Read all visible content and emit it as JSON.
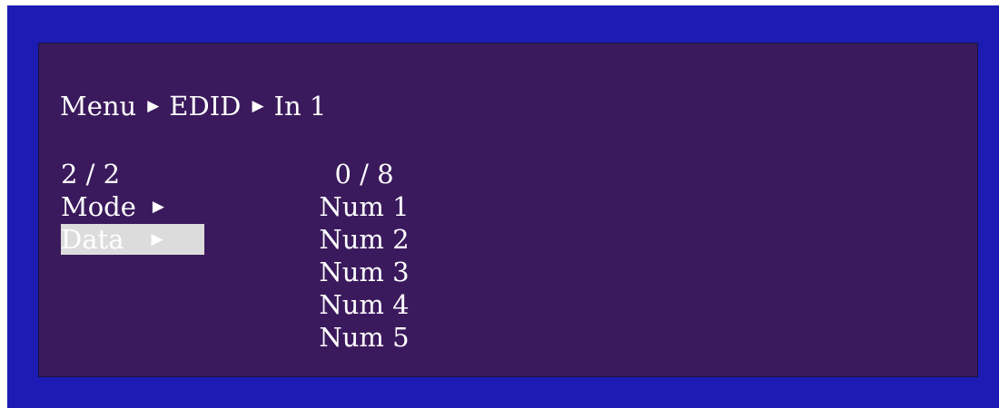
{
  "breadcrumb": {
    "items": [
      "Menu",
      "EDID",
      "In 1"
    ],
    "separator": "▶"
  },
  "left_menu": {
    "page": "2 / 2",
    "items": [
      {
        "label": "Mode",
        "arrow": "▶",
        "selected": false
      },
      {
        "label": "Data",
        "arrow": "▶",
        "selected": true
      }
    ]
  },
  "right_list": {
    "counter": "0 / 8",
    "items": [
      "Num 1",
      "Num 2",
      "Num 3",
      "Num 4",
      "Num 5"
    ]
  },
  "colors": {
    "outer_background": "#1c1cb4",
    "panel_background": "#3a1a5c",
    "text": "#ffffff",
    "highlight": "#dcdcdc"
  }
}
